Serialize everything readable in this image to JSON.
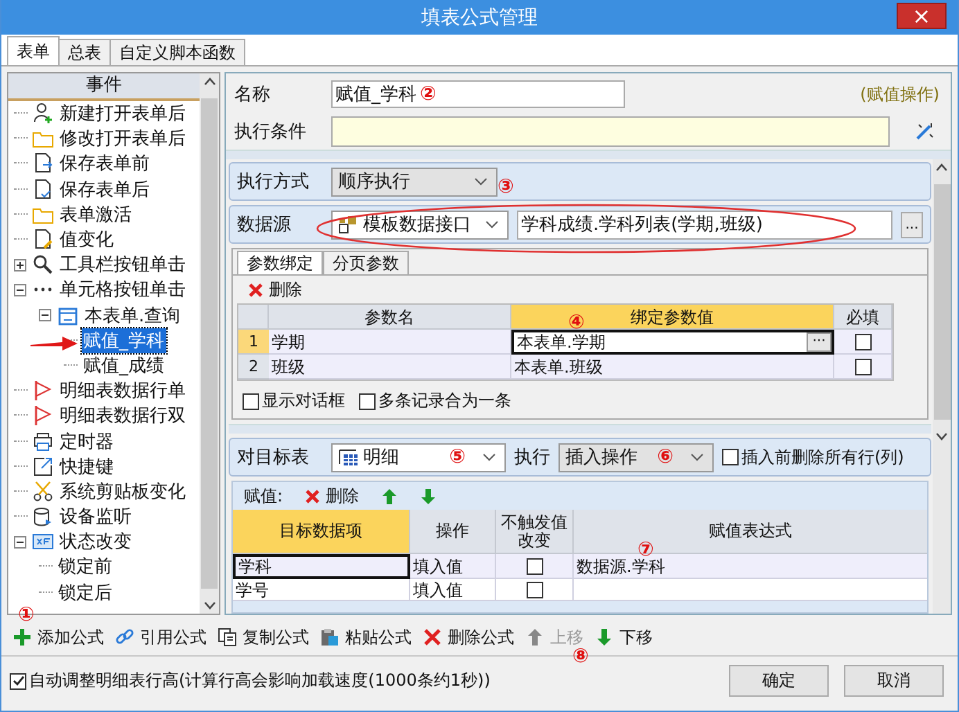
{
  "window": {
    "title": "填表公式管理",
    "close": "×"
  },
  "tabs": [
    {
      "label": "表单",
      "selected": true
    },
    {
      "label": "总表",
      "selected": false
    },
    {
      "label": "自定义脚本函数",
      "selected": false
    }
  ],
  "event_tree": {
    "header": "事件",
    "items": [
      {
        "label": "新建打开表单后",
        "selected": false
      },
      {
        "label": "修改打开表单后",
        "selected": false
      },
      {
        "label": "保存表单前",
        "selected": false
      },
      {
        "label": "保存表单后",
        "selected": false
      },
      {
        "label": "表单激活",
        "selected": false
      },
      {
        "label": "值变化",
        "selected": false
      },
      {
        "label": "工具栏按钮单击",
        "selected": false,
        "expanded": false
      },
      {
        "label": "单元格按钮单击",
        "selected": false,
        "expanded": true,
        "children": [
          {
            "label": "本表单.查询",
            "selected": false,
            "expanded": true,
            "children": [
              {
                "label": "赋值_学科",
                "selected": true
              },
              {
                "label": "赋值_成绩",
                "selected": false
              }
            ]
          }
        ]
      },
      {
        "label": "明细表数据行单",
        "selected": false
      },
      {
        "label": "明细表数据行双",
        "selected": false
      },
      {
        "label": "定时器",
        "selected": false
      },
      {
        "label": "快捷键",
        "selected": false
      },
      {
        "label": "系统剪贴板变化",
        "selected": false
      },
      {
        "label": "设备监听",
        "selected": false
      },
      {
        "label": "状态改变",
        "selected": false,
        "expanded": true,
        "children": [
          {
            "label": "锁定前",
            "selected": false
          },
          {
            "label": "锁定后",
            "selected": false
          }
        ]
      }
    ]
  },
  "form": {
    "name_label": "名称",
    "name_value": "赋值_学科",
    "type_note": "(赋值操作)",
    "condition_label": "执行条件"
  },
  "exec_mode": {
    "label": "执行方式",
    "value": "顺序执行"
  },
  "datasource": {
    "label": "数据源",
    "type": "模板数据接口",
    "value": "学科成绩.学科列表(学期,班级)",
    "browse": "..."
  },
  "param_tabs": [
    {
      "label": "参数绑定",
      "selected": true
    },
    {
      "label": "分页参数",
      "selected": false
    }
  ],
  "param_toolbar": {
    "delete": "删除"
  },
  "param_table": {
    "columns": [
      "参数名",
      "绑定参数值",
      "必填"
    ],
    "rows": [
      {
        "number": "1",
        "name": "学期",
        "value": "本表单.学期",
        "required": false,
        "selected": true,
        "edit_button": "···"
      },
      {
        "number": "2",
        "name": "班级",
        "value": "本表单.班级",
        "required": false,
        "selected": false
      }
    ]
  },
  "param_options": [
    {
      "label": "显示对话框",
      "checked": false
    },
    {
      "label": "多条记录合为一条",
      "checked": false
    }
  ],
  "target": {
    "label": "对目标表",
    "value": "明细",
    "exec_label": "执行",
    "exec_value": "插入操作",
    "clear_option": {
      "label": "插入前删除所有行(列)",
      "checked": false
    }
  },
  "assign_toolbar": {
    "label": "赋值:",
    "delete": "删除"
  },
  "assign_table": {
    "columns": [
      "目标数据项",
      "操作",
      "不触发值改变",
      "赋值表达式"
    ],
    "rows": [
      {
        "target": "学科",
        "operation": "填入值",
        "no_trigger": false,
        "expression": "数据源.学科",
        "selected": true
      },
      {
        "target": "学号",
        "operation": "填入值",
        "no_trigger": false,
        "selected": false
      }
    ]
  },
  "actions": [
    {
      "label": "添加公式",
      "disabled": false
    },
    {
      "label": "引用公式",
      "disabled": false
    },
    {
      "label": "复制公式",
      "disabled": false
    },
    {
      "label": "粘贴公式",
      "disabled": false
    },
    {
      "label": "删除公式",
      "disabled": false
    },
    {
      "label": "上移",
      "disabled": true
    },
    {
      "label": "下移",
      "disabled": false
    }
  ],
  "auto_height": {
    "label": "自动调整明细表行高(计算行高会影响加载速度(1000条约1秒))",
    "checked": true
  },
  "buttons": [
    "确定",
    "取消"
  ],
  "annotations": [
    "①",
    "②",
    "③",
    "④",
    "⑤",
    "⑥",
    "⑦",
    "⑧"
  ]
}
